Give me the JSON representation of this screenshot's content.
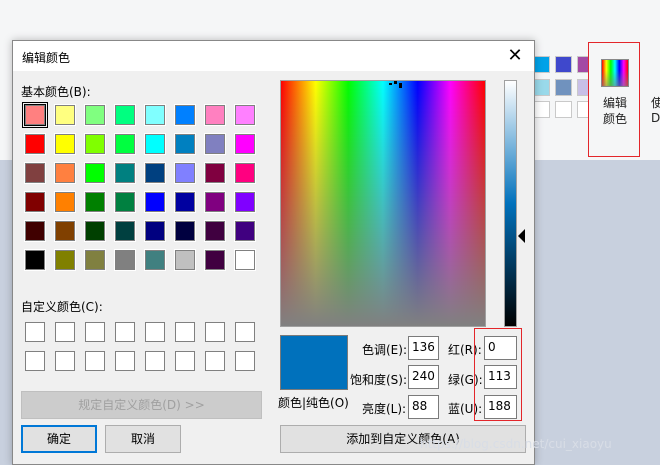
{
  "dialog": {
    "title": "编辑颜色",
    "basic_colors_label": "基本颜色(B):",
    "custom_colors_label": "自定义颜色(C):",
    "define_custom_button": "规定自定义颜色(D) >>",
    "ok_button": "确定",
    "cancel_button": "取消",
    "color_solid_label": "颜色|纯色(O)",
    "hue_label": "色调(E):",
    "hue_value": "136",
    "sat_label": "饱和度(S):",
    "sat_value": "240",
    "lum_label": "亮度(L):",
    "lum_value": "88",
    "red_label": "红(R):",
    "red_value": "0",
    "green_label": "绿(G):",
    "green_value": "113",
    "blue_label": "蓝(U):",
    "blue_value": "188",
    "add_custom_button": "添加到自定义颜色(A)",
    "preview_color": "#0071bc",
    "basic_colors": [
      [
        "#ff8080",
        "#ffff80",
        "#80ff80",
        "#00ff80",
        "#80ffff",
        "#0080ff",
        "#ff80c0",
        "#ff80ff"
      ],
      [
        "#ff0000",
        "#ffff00",
        "#80ff00",
        "#00ff40",
        "#00ffff",
        "#0080c0",
        "#8080c0",
        "#ff00ff"
      ],
      [
        "#804040",
        "#ff8040",
        "#00ff00",
        "#008080",
        "#004080",
        "#8080ff",
        "#800040",
        "#ff0080"
      ],
      [
        "#800000",
        "#ff8000",
        "#008000",
        "#008040",
        "#0000ff",
        "#0000a0",
        "#800080",
        "#8000ff"
      ],
      [
        "#400000",
        "#804000",
        "#004000",
        "#004040",
        "#000080",
        "#000040",
        "#400040",
        "#400080"
      ],
      [
        "#000000",
        "#808000",
        "#808040",
        "#808080",
        "#408080",
        "#c0c0c0",
        "#400040",
        "#ffffff"
      ]
    ]
  },
  "ribbon": {
    "edit_colors_label_1": "编辑",
    "edit_colors_label_2": "颜色",
    "side_text_1": "使",
    "side_text_2": "D",
    "swatches": [
      "#00a2e8",
      "#3f48cc",
      "#a349a4",
      "#99d9ea",
      "#7092be",
      "#c8bfe7"
    ]
  },
  "watermark": "https://blog.csdn.net/cui_xiaoyu"
}
